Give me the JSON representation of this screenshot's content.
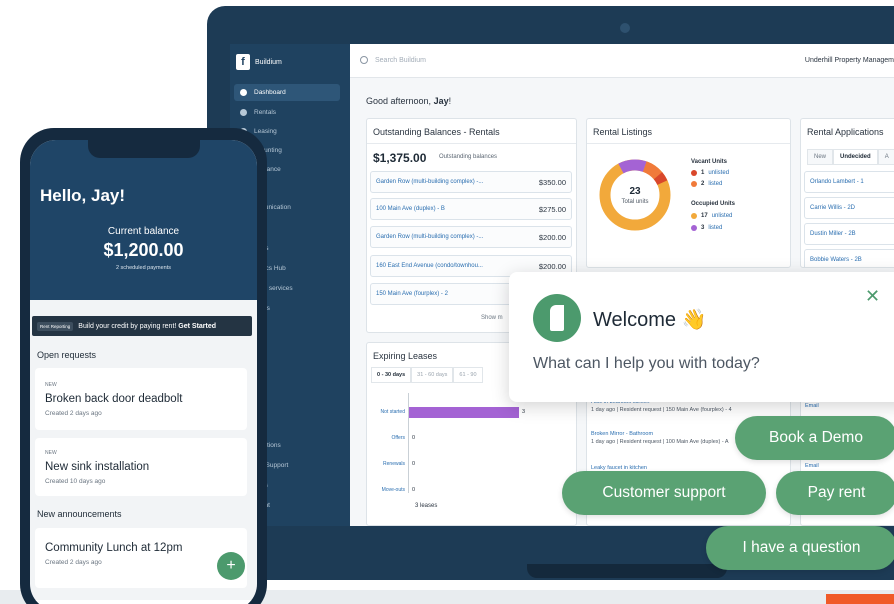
{
  "sidebar": {
    "brand": "Buildium",
    "items": [
      {
        "label": "Dashboard",
        "active": true
      },
      {
        "label": "Rentals"
      },
      {
        "label": "Leasing"
      },
      {
        "label": "ccounting"
      },
      {
        "label": "ntenance"
      },
      {
        "label": "ks"
      },
      {
        "label": "mmunication"
      },
      {
        "label": "s"
      },
      {
        "label": "ports"
      },
      {
        "label": "alytics Hub"
      },
      {
        "label": "d-on services"
      },
      {
        "label": "ortals"
      },
      {
        "label": "egrations"
      },
      {
        "label": "p & Support"
      },
      {
        "label": "tings"
      },
      {
        "label": "count"
      }
    ]
  },
  "topbar": {
    "search_placeholder": "Search Buildium",
    "company": "Underhill Property Managem"
  },
  "greeting": {
    "prefix": "Good afternoon, ",
    "name": "Jay",
    "suffix": "!"
  },
  "outstanding": {
    "title": "Outstanding Balances - Rentals",
    "total": "$1,375.00",
    "total_label": "Outstanding balances",
    "rows": [
      {
        "name": "Garden Row (multi-building complex) -...",
        "amount": "$350.00"
      },
      {
        "name": "100 Main Ave (duplex) - B",
        "amount": "$275.00"
      },
      {
        "name": "Garden Row (multi-building complex) -...",
        "amount": "$200.00"
      },
      {
        "name": "160 East End Avenue (condo/townhou...",
        "amount": "$200.00"
      },
      {
        "name": "150 Main Ave (fourplex) - 2",
        "amount": ""
      }
    ],
    "show_more": "Show m"
  },
  "listings": {
    "title": "Rental Listings",
    "total_value": "23",
    "total_label": "Total units",
    "vacant_heading": "Vacant Units",
    "vacant": [
      {
        "count": "1",
        "label": "unlisted",
        "color": "#d9472b"
      },
      {
        "count": "2",
        "label": "listed",
        "color": "#f07a3a"
      }
    ],
    "occupied_heading": "Occupied Units",
    "occupied": [
      {
        "count": "17",
        "label": "unlisted",
        "color": "#f2a93b"
      },
      {
        "count": "3",
        "label": "listed",
        "color": "#a463d4"
      }
    ]
  },
  "applications": {
    "title": "Rental Applications",
    "tabs": [
      "New",
      "Undecided",
      "A"
    ],
    "active_tab": "Undecided",
    "rows": [
      "Orlando Lambert - 1",
      "Carrie Willis - 2D",
      "Dustin Miller - 2B",
      "Bobbie Waters - 2B"
    ]
  },
  "expiring": {
    "title": "Expiring Leases",
    "tabs": [
      "0 - 30 days",
      "31 - 60 days",
      "61 - 90"
    ],
    "active_tab": "0 - 30 days",
    "total_label": "3 leases"
  },
  "chart_data": {
    "type": "bar",
    "orientation": "horizontal",
    "categories": [
      "Not started",
      "Offers",
      "Renewals",
      "Move-outs"
    ],
    "values": [
      3,
      0,
      0,
      0
    ],
    "xlim": [
      0,
      3
    ]
  },
  "feed": [
    {
      "title": "Hole in bedroom screen",
      "sub": "1 day ago | Resident request | 150 Main Ave (fourplex) - 4"
    },
    {
      "title": "Broken Mirror - Bathroom",
      "sub": "1 day ago | Resident request | 100 Main Ave (duplex) - A"
    },
    {
      "title": "Leaky faucet in kitchen",
      "sub": ""
    }
  ],
  "feed_right": [
    "Email",
    "Email"
  ],
  "chat": {
    "title": "Welcome",
    "wave": "👋",
    "subtitle": "What can I help you with today?",
    "close": "✕",
    "buttons": {
      "book_demo": "Book a Demo",
      "customer_support": "Customer support",
      "pay_rent": "Pay rent",
      "question": "I have a question"
    },
    "accent": "#5aa273"
  },
  "phone": {
    "hello": "Hello, Jay!",
    "balance_label": "Current balance",
    "balance": "$1,200.00",
    "balance_sub": "2 scheduled payments",
    "promo_tag": "Rent Reporting",
    "promo_text": "Build your credit by paying rent!",
    "promo_cta": "Get Started",
    "open_requests": "Open requests",
    "requests": [
      {
        "badge": "NEW",
        "title": "Broken back door deadbolt",
        "meta": "Created 2 days ago"
      },
      {
        "badge": "NEW",
        "title": "New sink installation",
        "meta": "Created 10 days ago"
      }
    ],
    "announcements": "New announcements",
    "announcement": {
      "title": "Community Lunch at 12pm",
      "meta": "Created 2 days ago"
    },
    "fab": "+"
  }
}
